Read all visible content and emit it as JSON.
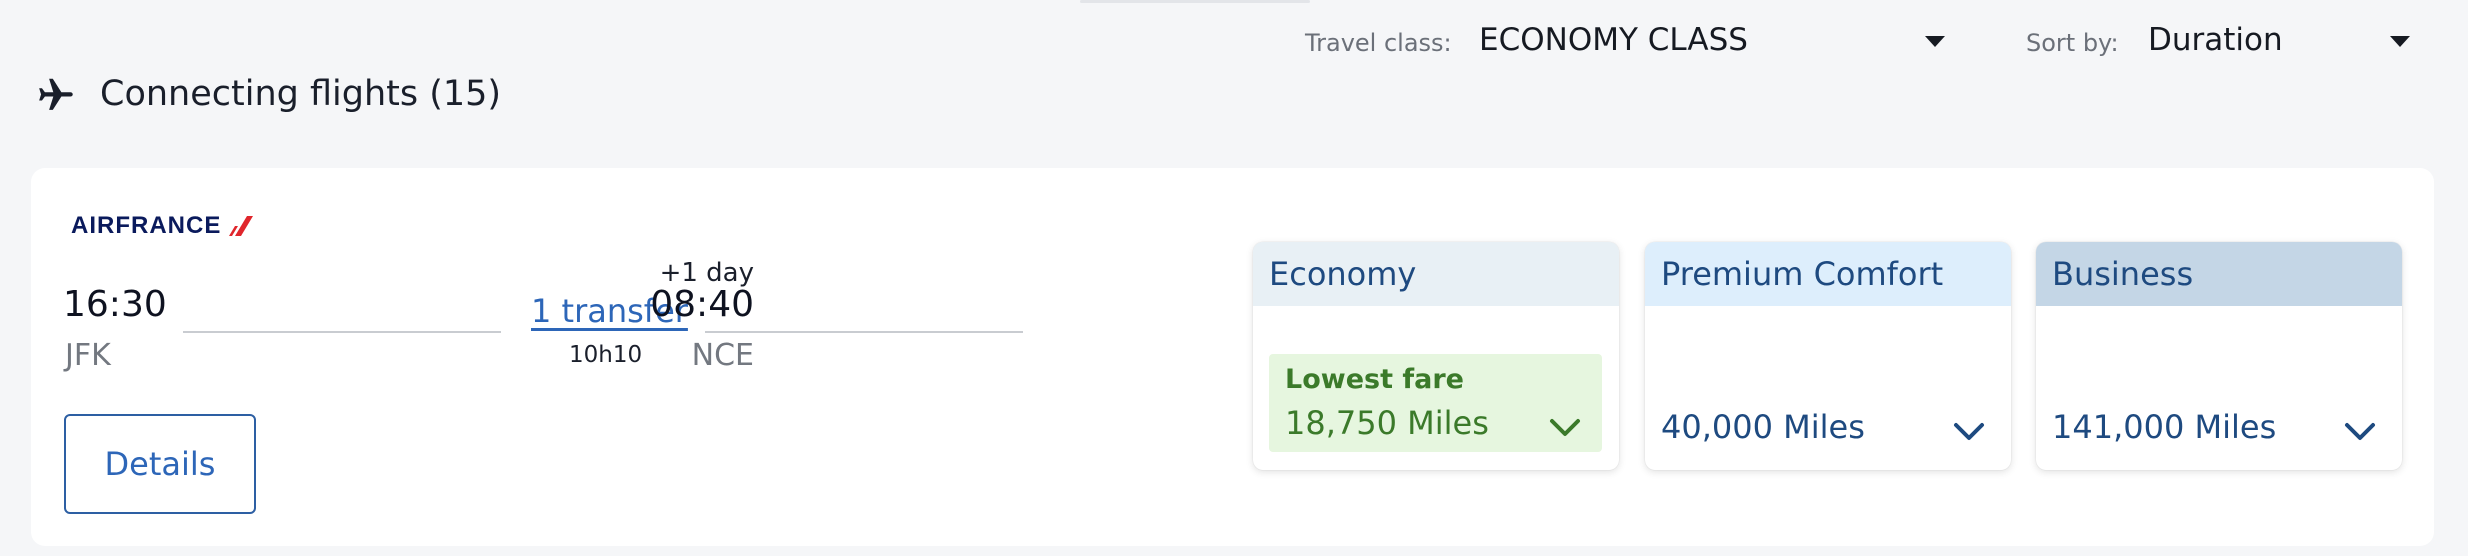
{
  "filters": {
    "travel_class": {
      "label": "Travel class:",
      "value": "ECONOMY CLASS"
    },
    "sort_by": {
      "label": "Sort by:",
      "value": "Duration"
    }
  },
  "heading": {
    "text": "Connecting flights (15)",
    "icon": "plane-icon"
  },
  "flight": {
    "airline": "AIRFRANCE",
    "departure": {
      "time": "16:30",
      "airport": "JFK"
    },
    "arrival": {
      "time": "08:40",
      "airport": "NCE",
      "day_offset": "+1 day"
    },
    "transfer": {
      "label": "1 transfer",
      "duration": "10h10"
    },
    "details_label": "Details"
  },
  "fares": [
    {
      "cabin": "Economy",
      "badge": "Lowest fare",
      "miles": "18,750 Miles",
      "color": "#3b7a2a"
    },
    {
      "cabin": "Premium Comfort",
      "miles": "40,000 Miles",
      "color": "#1e4a80"
    },
    {
      "cabin": "Business",
      "miles": "141,000 Miles",
      "color": "#1e4a80"
    }
  ],
  "colors": {
    "accent": "#2d66b8",
    "brand_navy": "#0a1a5c",
    "brand_red": "#e0262c",
    "lowest_green": "#3b7a2a"
  }
}
